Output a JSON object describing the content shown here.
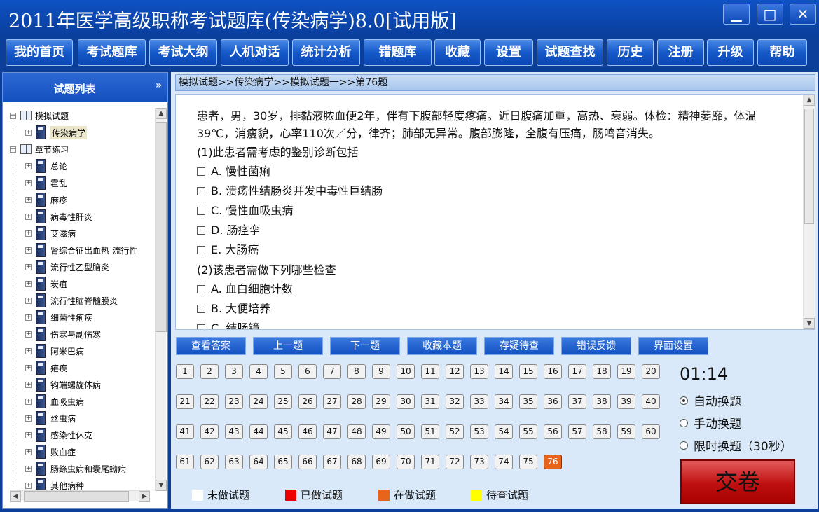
{
  "window": {
    "title": "2011年医学高级职称考试题库(传染病学)8.0[试用版]",
    "min_glyph": "▁",
    "max_glyph": "□",
    "close_glyph": "✕"
  },
  "menu": [
    "我的首页",
    "考试题库",
    "考试大纲",
    "人机对话",
    "统计分析",
    "错题库",
    "收藏",
    "设置",
    "试题查找",
    "历史",
    "注册",
    "升级",
    "帮助"
  ],
  "sidebar": {
    "title": "试题列表",
    "collapse_icon": "»",
    "tree": {
      "groups": [
        {
          "label": "模拟试题",
          "items": [
            "传染病学"
          ]
        },
        {
          "label": "章节练习",
          "items": [
            "总论",
            "霍乱",
            "麻疹",
            "病毒性肝炎",
            "艾滋病",
            "肾综合征出血热-流行性",
            "流行性乙型脑炎",
            "炭疽",
            "流行性脑脊髓膜炎",
            "细菌性痢疾",
            "伤寒与副伤寒",
            "阿米巴病",
            "疟疾",
            "钩端螺旋体病",
            "血吸虫病",
            "丝虫病",
            "感染性休克",
            "败血症",
            "肠绦虫病和囊尾蚴病",
            "其他病种"
          ]
        }
      ],
      "selected": "传染病学"
    }
  },
  "main": {
    "breadcrumb": "模拟试题>>传染病学>>模拟试题一>>第76题",
    "question": {
      "stem": "患者，男，30岁，排黏液脓血便2年，伴有下腹部轻度疼痛。近日腹痛加重，高热、衰弱。体检：精神萎靡，体温39℃，消瘦貌，心率110次／分，律齐；肺部无异常。腹部膨隆，全腹有压痛，肠鸣音消失。",
      "parts": [
        {
          "prompt": "(1)此患者需考虑的鉴别诊断包括",
          "options": [
            "A. 慢性菌痢",
            "B. 溃疡性结肠炎并发中毒性巨结肠",
            "C. 慢性血吸虫病",
            "D. 肠痉挛",
            "E. 大肠癌"
          ]
        },
        {
          "prompt": "(2)该患者需做下列哪些检查",
          "options": [
            "A. 血白细胞计数",
            "B. 大便培养",
            "C. 结肠镜"
          ]
        }
      ]
    },
    "actions": [
      "查看答案",
      "上一题",
      "下一题",
      "收藏本题",
      "存疑待查",
      "错误反馈",
      "界面设置"
    ],
    "question_numbers": {
      "total": 76,
      "current": 76
    },
    "timer": "01:14",
    "mode_options": [
      {
        "label": "自动换题",
        "selected": true
      },
      {
        "label": "手动换题",
        "selected": false
      },
      {
        "label": "限时换题（30秒）",
        "selected": false
      }
    ],
    "submit_label": "交卷",
    "legend": [
      {
        "label": "未做试题",
        "color": "#ffffff"
      },
      {
        "label": "已做试题",
        "color": "#ee0000"
      },
      {
        "label": "在做试题",
        "color": "#e8641a"
      },
      {
        "label": "待查试题",
        "color": "#ffff00"
      }
    ]
  }
}
